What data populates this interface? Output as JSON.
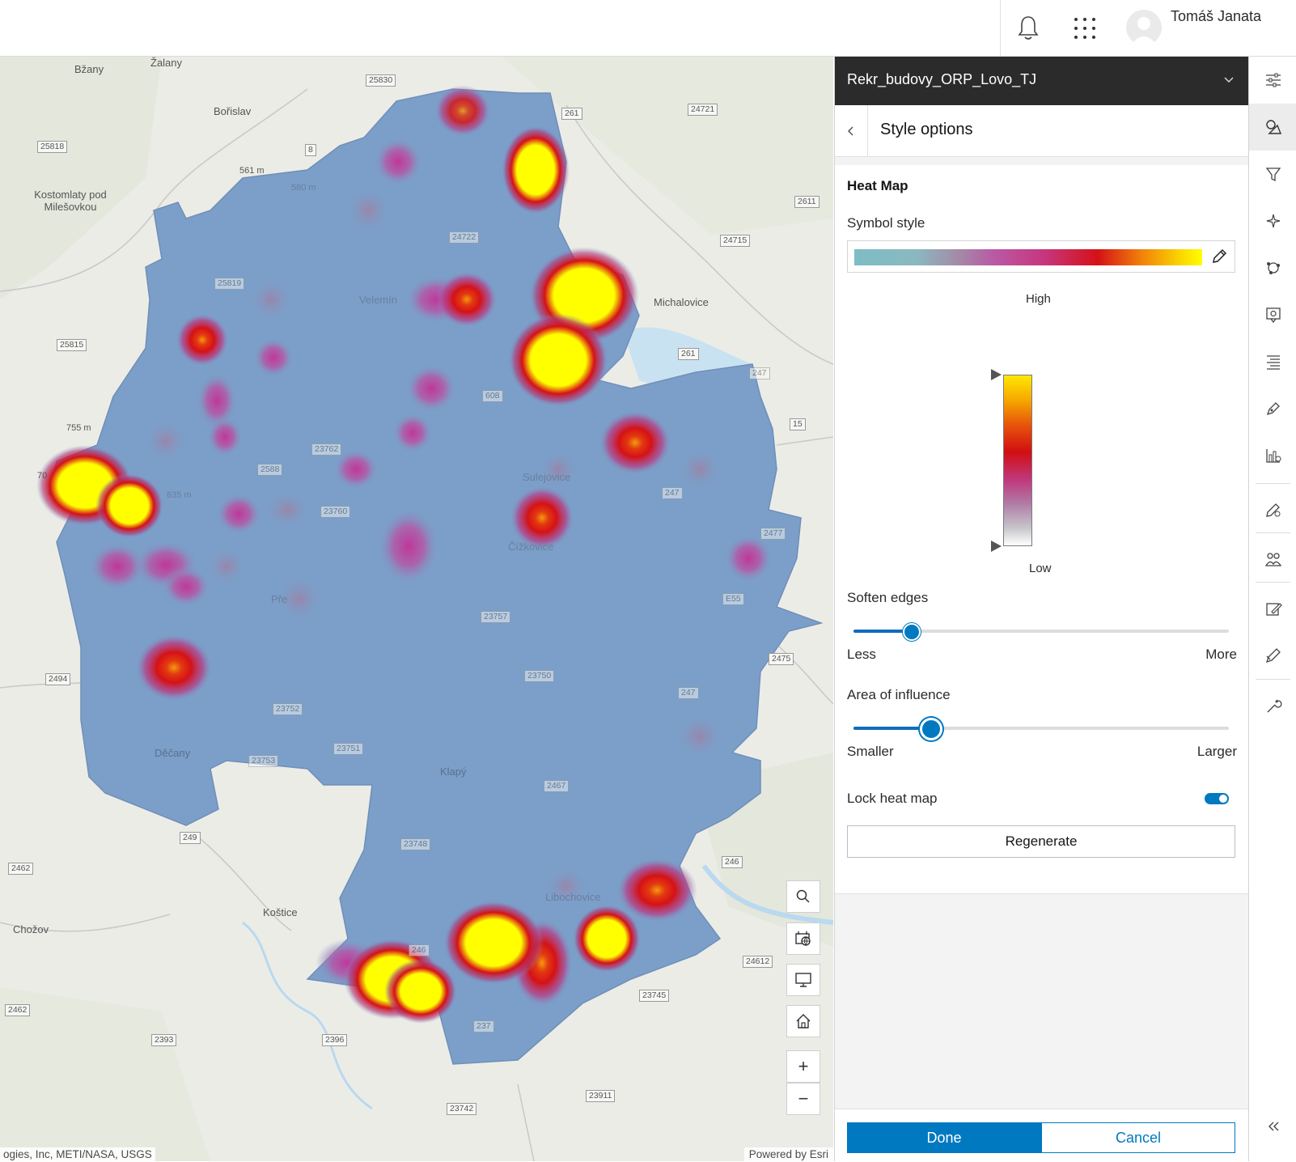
{
  "header": {
    "user_name": "Tomáš Janata",
    "icons": [
      "bell-icon",
      "apps-grid-icon",
      "avatar"
    ]
  },
  "map": {
    "place_labels": [
      "Bžany",
      "Žalany",
      "Bořislav",
      "Kostomlaty pod Milešovkou",
      "Velemín",
      "Michalovice",
      "Sulejovice",
      "Čížkovice",
      "Děčany",
      "Klapý",
      "Koštice",
      "Chožov",
      "Libochovice",
      "Pře"
    ],
    "elevation_labels": [
      "561 m",
      "580 m",
      "755 m",
      "635 m",
      "70"
    ],
    "road_numbers": [
      "25830",
      "25818",
      "8",
      "261",
      "24721",
      "2611",
      "24722",
      "24715",
      "25819",
      "25815",
      "261",
      "247",
      "15",
      "608",
      "23762",
      "2588",
      "23760",
      "247",
      "2477",
      "E55",
      "23757",
      "2475",
      "2494",
      "23750",
      "247",
      "23752",
      "23753",
      "23751",
      "2467",
      "249",
      "2462",
      "23748",
      "246",
      "246",
      "24612",
      "23745",
      "2462",
      "2393",
      "2396",
      "237",
      "23911",
      "23742"
    ],
    "attribution_left": "ogies, Inc, METI/NASA, USGS",
    "attribution_right": "Powered by Esri",
    "controls": {
      "zoom_in": "+",
      "zoom_out": "−"
    },
    "colors": {
      "boundary_fill": "#7b9fc9",
      "heat_low": "#c0569f",
      "heat_mid": "#d51117",
      "heat_high": "#ffff00"
    }
  },
  "panel": {
    "layer_name": "Rekr_budovy_ORP_Lovo_TJ",
    "header_title": "Style options",
    "section_title": "Heat Map",
    "symbol_style_label": "Symbol style",
    "ramp_high_label": "High",
    "ramp_low_label": "Low",
    "soften_edges": {
      "label": "Soften edges",
      "min_label": "Less",
      "max_label": "More",
      "value": 0.15
    },
    "area_of_influence": {
      "label": "Area of influence",
      "min_label": "Smaller",
      "max_label": "Larger",
      "value": 0.2
    },
    "lock_heat_map": {
      "label": "Lock heat map",
      "on": true
    },
    "regenerate_label": "Regenerate",
    "done_label": "Done",
    "cancel_label": "Cancel",
    "accent_color": "#0079c1"
  },
  "toolbar": {
    "icons": [
      "properties-icon",
      "styles-icon",
      "filter-icon",
      "effects-icon",
      "clustering-icon",
      "configure-pop-ups-icon",
      "labels-icon",
      "sketch-icon",
      "charts-icon",
      "edit-icon",
      "analysis-icon",
      "field-maps-icon",
      "tracking-icon",
      "tools-icon",
      "collapse-icon"
    ],
    "active": "styles-icon"
  }
}
